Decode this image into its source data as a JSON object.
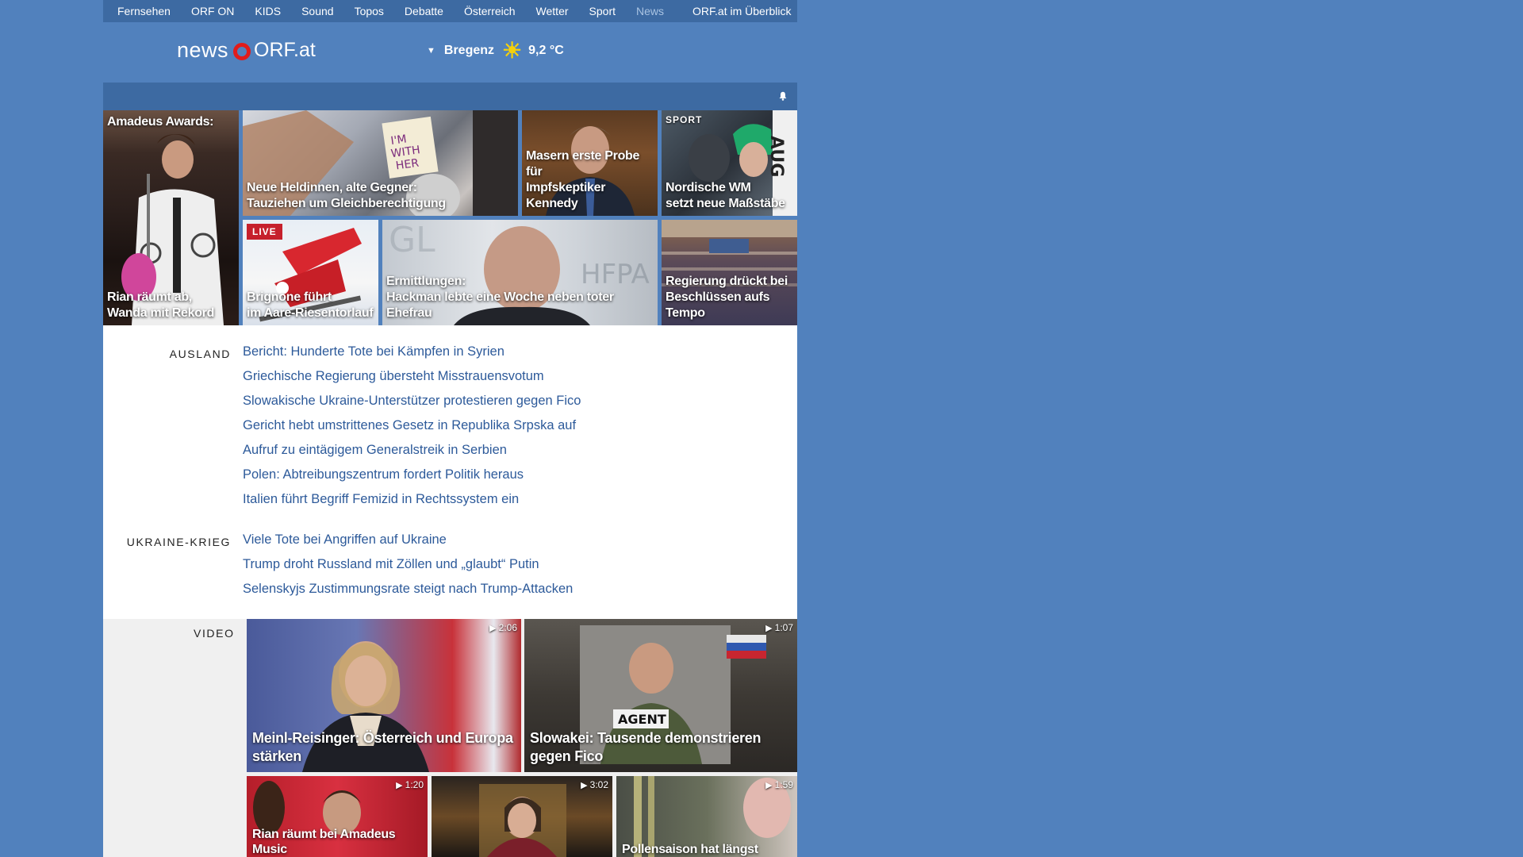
{
  "nav": {
    "items": [
      "Fernsehen",
      "ORF ON",
      "KIDS",
      "Sound",
      "Topos",
      "Debatte",
      "Österreich",
      "Wetter",
      "Sport",
      "News"
    ],
    "current": "News",
    "overview": "ORF.at im Überblick"
  },
  "header": {
    "logo_news": "news",
    "logo_orf": "ORF.at",
    "weather": {
      "city": "Bregenz",
      "temp": "9,2 °C",
      "icon": "sun-icon"
    }
  },
  "teasers": [
    {
      "top_label": "Amadeus Awards:",
      "title_l1": "Rian räumt ab,",
      "title_l2": "Wanda mit Rekord"
    },
    {
      "title_l1": "Neue Heldinnen, alte Gegner:",
      "title_l2": "Tauziehen um Gleichberechtigung"
    },
    {
      "title_l1": "Masern erste Probe für",
      "title_l2": "Impfskeptiker Kennedy"
    },
    {
      "kicker": "SPORT",
      "title_l1": "Nordische WM",
      "title_l2": "setzt neue Maßstäbe"
    },
    {
      "badge": "LIVE",
      "title_l1": "Brignone führt",
      "title_l2": "im Aare-Riesentorlauf"
    },
    {
      "title_l1": "Ermittlungen:",
      "title_l2": "Hackman lebte eine Woche neben toter Ehefrau"
    },
    {
      "title_l1": "Regierung drückt bei",
      "title_l2": "Beschlüssen aufs Tempo"
    }
  ],
  "sections": [
    {
      "label": "AUSLAND",
      "items": [
        "Bericht: Hunderte Tote bei Kämpfen in Syrien",
        "Griechische Regierung übersteht Misstrauensvotum",
        "Slowakische Ukraine-Unterstützer protestieren gegen Fico",
        "Gericht hebt umstrittenes Gesetz in Republika Srpska auf",
        "Aufruf zu eintägigem Generalstreik in Serbien",
        "Polen: Abtreibungszentrum fordert Politik heraus",
        "Italien führt Begriff Femizid in Rechtssystem ein"
      ]
    },
    {
      "label": "UKRAINE-KRIEG",
      "items": [
        "Viele Tote bei Angriffen auf Ukraine",
        "Trump droht Russland mit Zöllen und „glaubt“ Putin",
        "Selenskyjs Zustimmungsrate steigt nach Trump-Attacken"
      ]
    }
  ],
  "video": {
    "label": "VIDEO",
    "items": [
      {
        "duration": "2:06",
        "title": "Meinl-Reisinger: Österreich und Europa stärken"
      },
      {
        "duration": "1:07",
        "title": "Slowakei: Tausende demonstrieren gegen Fico"
      },
      {
        "duration": "1:20",
        "title": "Rian räumt bei Amadeus Music"
      },
      {
        "duration": "3:02",
        "title": ""
      },
      {
        "duration": "1:59",
        "title": "Pollensaison hat längst"
      }
    ]
  },
  "colors": {
    "background": "#5181bd",
    "nav_bar": "#3d6aa2",
    "link": "#2d5a9a",
    "live_badge": "#c6202c",
    "logo_ring": "#e11b1b"
  }
}
